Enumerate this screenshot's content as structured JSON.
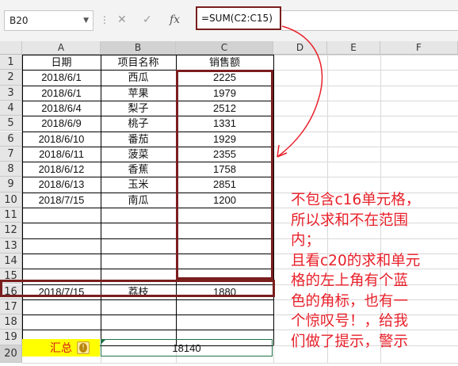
{
  "name_box": "B20",
  "formula": "=SUM(C2:C15)",
  "columns": [
    "A",
    "B",
    "C",
    "D",
    "E",
    "F"
  ],
  "rows": [
    "1",
    "2",
    "3",
    "4",
    "5",
    "6",
    "7",
    "8",
    "9",
    "10",
    "11",
    "12",
    "13",
    "14",
    "15",
    "16",
    "17",
    "18",
    "19",
    "20"
  ],
  "header": {
    "date": "日期",
    "item": "项目名称",
    "sales": "销售额"
  },
  "data": [
    {
      "date": "2018/6/1",
      "item": "西瓜",
      "sales": "2225"
    },
    {
      "date": "2018/6/1",
      "item": "苹果",
      "sales": "1979"
    },
    {
      "date": "2018/6/4",
      "item": "梨子",
      "sales": "2512"
    },
    {
      "date": "2018/6/9",
      "item": "桃子",
      "sales": "1331"
    },
    {
      "date": "2018/6/10",
      "item": "番茄",
      "sales": "1929"
    },
    {
      "date": "2018/6/11",
      "item": "菠菜",
      "sales": "2355"
    },
    {
      "date": "2018/6/12",
      "item": "香蕉",
      "sales": "1758"
    },
    {
      "date": "2018/6/13",
      "item": "玉米",
      "sales": "2851"
    },
    {
      "date": "2018/7/15",
      "item": "南瓜",
      "sales": "1200"
    }
  ],
  "row16": {
    "date": "2018/7/15",
    "item": "荔枝",
    "sales": "1880"
  },
  "summary": {
    "label": "汇总",
    "value": "18140"
  },
  "annotation": [
    "不包含c16单元格，",
    "所以求和不在范围",
    "内；",
    "且看c20的求和单元",
    "格的左上角有个蓝",
    "色的角标，也有一",
    "个惊叹号！，给我",
    "们做了提示，警示"
  ],
  "colors": {
    "annotation": "#e8202a",
    "highlight_box": "#7a1e1e",
    "summary_fill": "#ffff00",
    "summary_text": "#d4141c"
  }
}
